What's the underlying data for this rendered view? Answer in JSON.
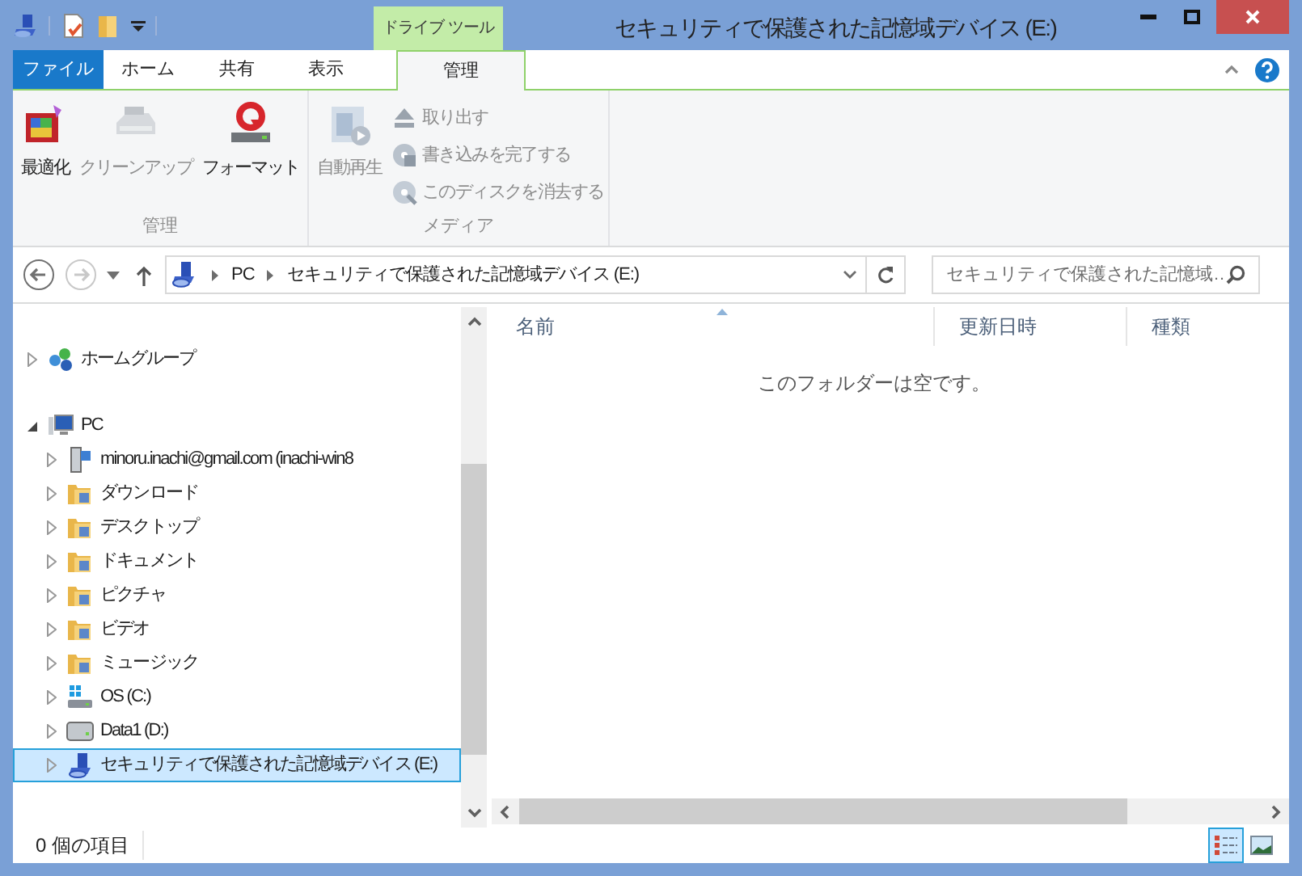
{
  "window": {
    "context_tab_header": "ドライブ ツール",
    "title": "セキュリティで保護された記憶域デバイス (E:)"
  },
  "tabs": [
    {
      "label": "ファイル",
      "kind": "file",
      "selected": false
    },
    {
      "label": "ホーム",
      "kind": "tab",
      "selected": false
    },
    {
      "label": "共有",
      "kind": "tab",
      "selected": false
    },
    {
      "label": "表示",
      "kind": "tab",
      "selected": false
    },
    {
      "label": "管理",
      "kind": "context",
      "selected": true
    }
  ],
  "ribbon": {
    "groups": [
      {
        "label": "管理",
        "buttons": [
          {
            "label": "最適化",
            "kind": "large",
            "disabled": false
          },
          {
            "label": "クリーンアップ",
            "kind": "large",
            "disabled": true
          },
          {
            "label": "フォーマット",
            "kind": "large",
            "disabled": false
          }
        ]
      },
      {
        "label": "メディア",
        "buttons": [
          {
            "label": "自動再生",
            "kind": "large",
            "disabled": true
          },
          {
            "label": "取り出す",
            "kind": "small",
            "disabled": true
          },
          {
            "label": "書き込みを完了する",
            "kind": "small",
            "disabled": true
          },
          {
            "label": "このディスクを消去する",
            "kind": "small",
            "disabled": true
          }
        ]
      }
    ]
  },
  "address_bar": {
    "breadcrumbs": [
      "PC",
      "セキュリティで保護された記憶域デバイス (E:)"
    ]
  },
  "search": {
    "placeholder": "セキュリティで保護された記憶域…"
  },
  "navigation_tree": [
    {
      "label": "ホームグループ",
      "kind": "homegroup",
      "expanded": false,
      "selected": false
    },
    {
      "label": "PC",
      "kind": "computer",
      "expanded": true,
      "selected": false,
      "children": [
        {
          "label": "minoru.inachi@gmail.com (inachi-win8",
          "kind": "cloud",
          "expanded": false,
          "selected": false
        },
        {
          "label": "ダウンロード",
          "kind": "folder",
          "expanded": false,
          "selected": false
        },
        {
          "label": "デスクトップ",
          "kind": "folder",
          "expanded": false,
          "selected": false
        },
        {
          "label": "ドキュメント",
          "kind": "folder",
          "expanded": false,
          "selected": false
        },
        {
          "label": "ピクチャ",
          "kind": "folder",
          "expanded": false,
          "selected": false
        },
        {
          "label": "ビデオ",
          "kind": "folder",
          "expanded": false,
          "selected": false
        },
        {
          "label": "ミュージック",
          "kind": "folder",
          "expanded": false,
          "selected": false
        },
        {
          "label": "OS (C:)",
          "kind": "system_drive",
          "expanded": false,
          "selected": false
        },
        {
          "label": "Data1 (D:)",
          "kind": "drive",
          "expanded": false,
          "selected": false
        },
        {
          "label": "セキュリティで保護された記憶域デバイス (E:)",
          "kind": "device",
          "expanded": false,
          "selected": true
        }
      ]
    }
  ],
  "file_list": {
    "columns": [
      "名前",
      "更新日時",
      "種類"
    ],
    "empty_message": "このフォルダーは空です。"
  },
  "status_bar": {
    "item_count": "0 個の項目"
  },
  "view_buttons": [
    {
      "kind": "details",
      "selected": true
    },
    {
      "kind": "large_icons",
      "selected": false
    }
  ]
}
